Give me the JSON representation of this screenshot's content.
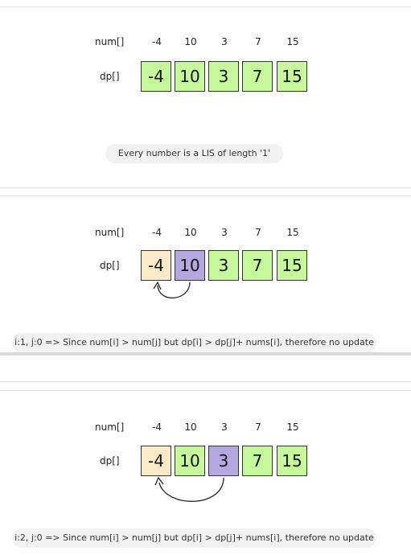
{
  "frames": [
    {
      "num_label": "num[]",
      "dp_label": "dp[]",
      "nums": [
        "-4",
        "10",
        "3",
        "7",
        "15"
      ],
      "dp": [
        "-4",
        "10",
        "3",
        "7",
        "15"
      ],
      "caption": "Every number is a LIS of length '1'"
    },
    {
      "num_label": "num[]",
      "dp_label": "dp[]",
      "nums": [
        "-4",
        "10",
        "3",
        "7",
        "15"
      ],
      "dp": [
        "-4",
        "10",
        "3",
        "7",
        "15"
      ],
      "caption": "i:1, j:0 => Since num[i] > num[j] but dp[i] > dp[j]+ nums[i], therefore no update"
    },
    {
      "num_label": "num[]",
      "dp_label": "dp[]",
      "nums": [
        "-4",
        "10",
        "3",
        "7",
        "15"
      ],
      "dp": [
        "-4",
        "10",
        "3",
        "7",
        "15"
      ],
      "caption": "i:2, j:0 => Since num[i] > num[j] but dp[i] > dp[j]+ nums[i], therefore no update"
    }
  ],
  "colors": {
    "default_cell": "#c5f99a",
    "j_cell": "#fdebc7",
    "i_cell": "#b3a8df",
    "caption_bg": "#f2f2f2"
  }
}
